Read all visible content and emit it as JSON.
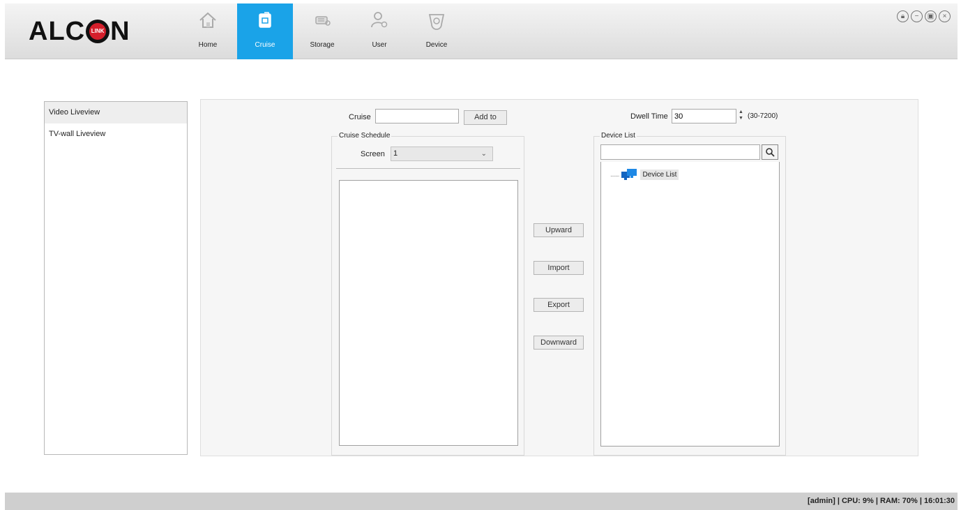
{
  "app": {
    "logo_text_left": "ALC",
    "logo_text_right": "N",
    "logo_badge": "LINK"
  },
  "nav": {
    "items": [
      {
        "label": "Home",
        "icon": "home-icon"
      },
      {
        "label": "Cruise",
        "icon": "cruise-icon"
      },
      {
        "label": "Storage",
        "icon": "storage-icon"
      },
      {
        "label": "User",
        "icon": "user-icon"
      },
      {
        "label": "Device",
        "icon": "device-icon"
      }
    ],
    "active_index": 1,
    "active_color": "#1aa3e8"
  },
  "window_controls": [
    "lock-icon",
    "minimize-icon",
    "restore-icon",
    "close-icon"
  ],
  "sidebar": {
    "items": [
      {
        "label": "Video Liveview"
      },
      {
        "label": "TV-wall Liveview"
      }
    ]
  },
  "cruise": {
    "label": "Cruise",
    "value": "",
    "add_button": "Add to"
  },
  "dwell": {
    "label": "Dwell Time",
    "value": "30",
    "range": "(30-7200)"
  },
  "schedule": {
    "title": "Cruise Schedule",
    "screen_label": "Screen",
    "screen_value": "1"
  },
  "actions": {
    "upward": "Upward",
    "import": "Import",
    "export": "Export",
    "downward": "Downward"
  },
  "device_list": {
    "title": "Device List",
    "search_value": "",
    "tree_root": "Device List"
  },
  "status_bar": {
    "text": "[admin] | CPU: 9% | RAM: 70% | 16:01:30"
  }
}
